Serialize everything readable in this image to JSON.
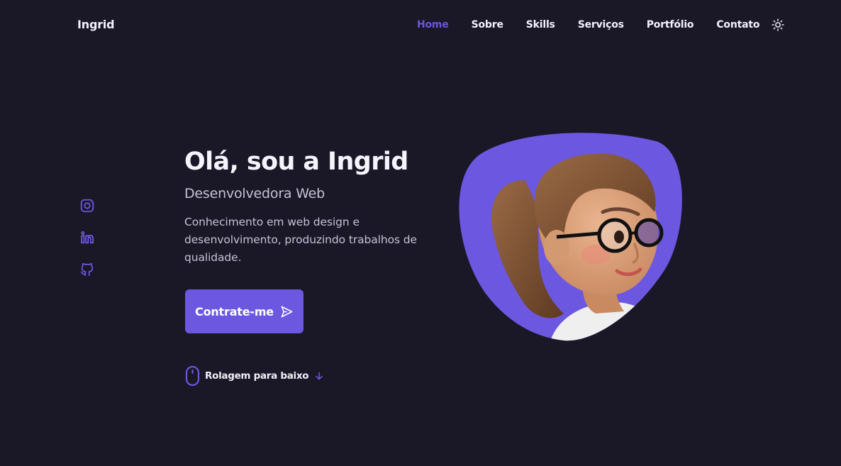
{
  "header": {
    "logo": "Ingrid",
    "nav": [
      {
        "label": "Home",
        "active": true
      },
      {
        "label": "Sobre"
      },
      {
        "label": "Skills"
      },
      {
        "label": "Serviços"
      },
      {
        "label": "Portfólio"
      },
      {
        "label": "Contato"
      }
    ],
    "theme_icon": "sun-icon"
  },
  "social": [
    {
      "icon": "instagram-icon"
    },
    {
      "icon": "linkedin-icon"
    },
    {
      "icon": "github-icon"
    }
  ],
  "hero": {
    "title": "Olá, sou a Ingrid",
    "subtitle": "Desenvolvedora Web",
    "description": "Conhecimento em web design e desenvolvimento, produzindo trabalhos de qualidade.",
    "cta_label": "Contrate-me",
    "cta_icon": "send-icon",
    "scroll_label": "Rolagem para baixo",
    "scroll_icons": [
      "mouse-icon",
      "arrow-down-icon"
    ],
    "avatar_icon": "avatar-image"
  },
  "colors": {
    "background": "#1a1727",
    "accent": "#6c57e0",
    "text": "#f1eff8",
    "muted_text": "#c6c2d7"
  }
}
